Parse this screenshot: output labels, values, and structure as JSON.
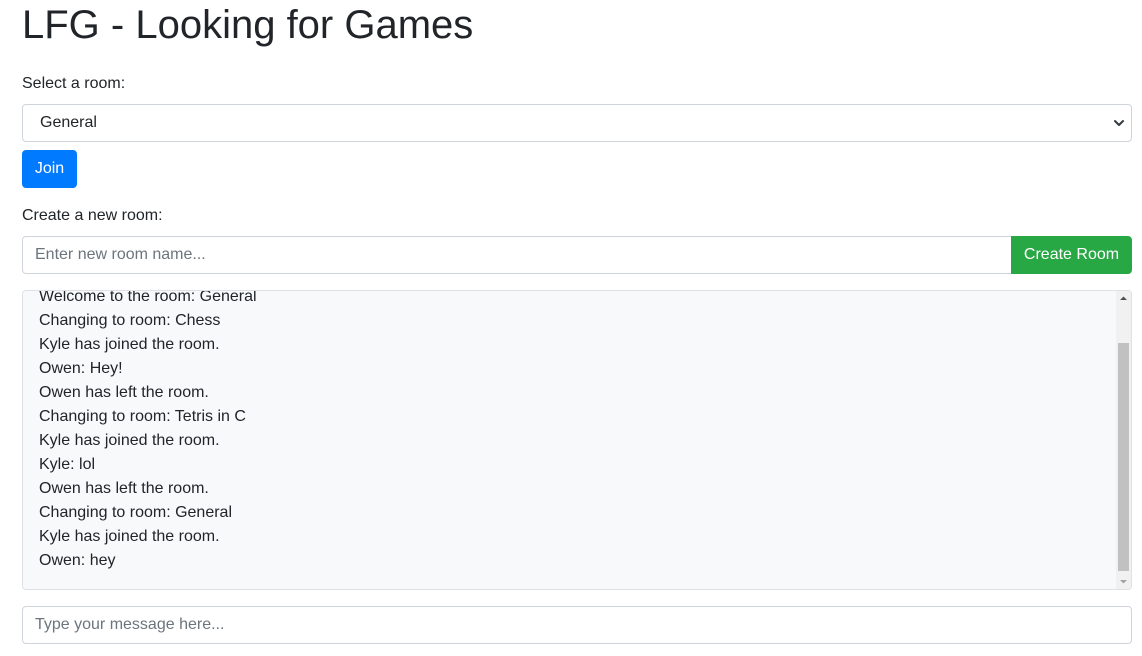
{
  "header": {
    "title": "LFG - Looking for Games"
  },
  "room_select": {
    "label": "Select a room:",
    "selected": "General",
    "join_label": "Join"
  },
  "create_room": {
    "label": "Create a new room:",
    "placeholder": "Enter new room name...",
    "button_label": "Create Room"
  },
  "chat": {
    "messages": [
      "Welcome to the room: General",
      "Changing to room: Chess",
      "Kyle has joined the room.",
      "Owen: Hey!",
      "Owen has left the room.",
      "Changing to room: Tetris in C",
      "Kyle has joined the room.",
      "Kyle: lol",
      "Owen has left the room.",
      "Changing to room: General",
      "Kyle has joined the room.",
      "Owen: hey"
    ]
  },
  "message_input": {
    "placeholder": "Type your message here..."
  },
  "icons": {
    "select_arrow": "chevron-down-icon",
    "scroll_up": "caret-up-icon",
    "scroll_down": "caret-down-icon"
  },
  "colors": {
    "join_button": "#007bff",
    "create_button": "#28a745",
    "chat_background": "#f8f9fa"
  }
}
